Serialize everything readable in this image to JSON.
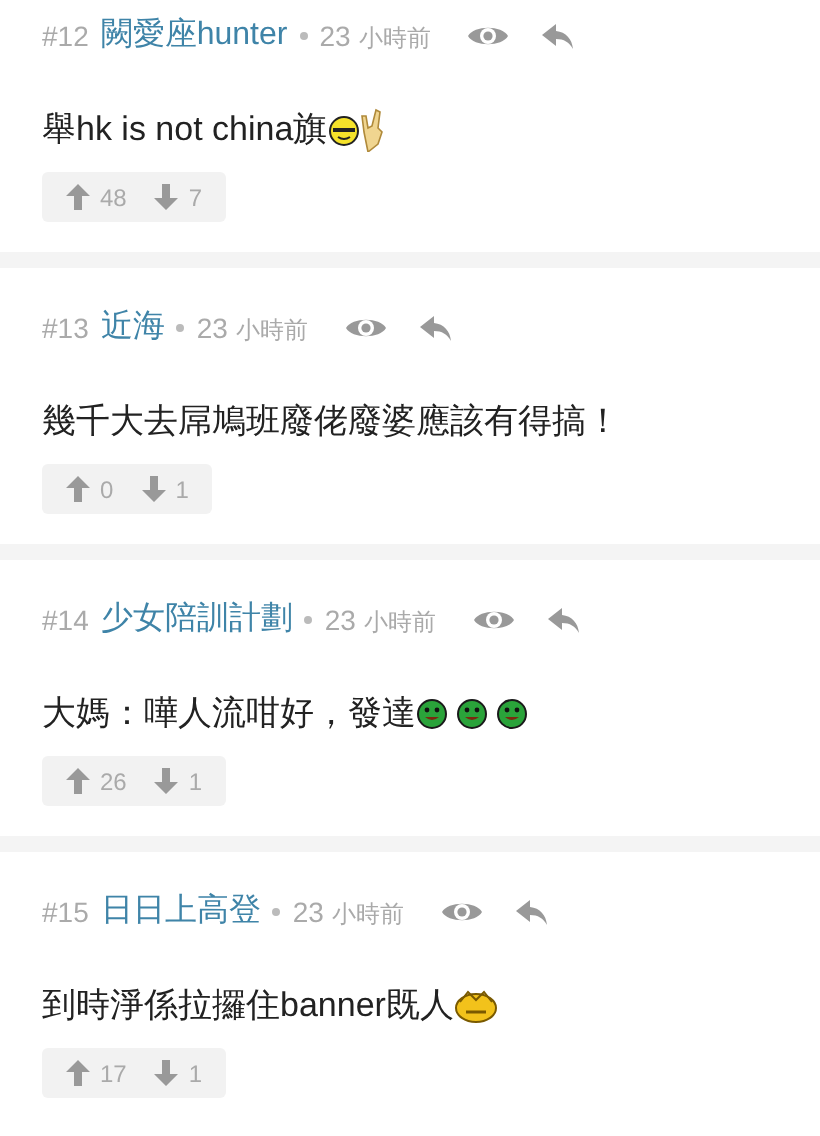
{
  "comments": [
    {
      "number": "#12",
      "author": "闕愛座hunter",
      "time_value": "23",
      "time_unit": "小時前",
      "body": "舉hk is not china旗",
      "emojis": [
        {
          "kind": "cool-face"
        },
        {
          "kind": "rock-hand"
        }
      ],
      "upvotes": "48",
      "downvotes": "7"
    },
    {
      "number": "#13",
      "author": "近海",
      "time_value": "23",
      "time_unit": "小時前",
      "body": "幾千大去屌鳩班廢佬廢婆應該有得搞！",
      "upvotes": "0",
      "downvotes": "1"
    },
    {
      "number": "#14",
      "author": "少女陪訓計劃",
      "time_value": "23",
      "time_unit": "小時前",
      "body": "大媽：嘩人流咁好，發達",
      "emojis": [
        {
          "kind": "green-face"
        },
        {
          "kind": "green-face"
        },
        {
          "kind": "green-face"
        }
      ],
      "upvotes": "26",
      "downvotes": "1"
    },
    {
      "number": "#15",
      "author": "日日上高登",
      "time_value": "23",
      "time_unit": "小時前",
      "body": "到時淨係拉攞住banner既人",
      "emojis": [
        {
          "kind": "yellow-face"
        }
      ],
      "upvotes": "17",
      "downvotes": "1"
    }
  ]
}
